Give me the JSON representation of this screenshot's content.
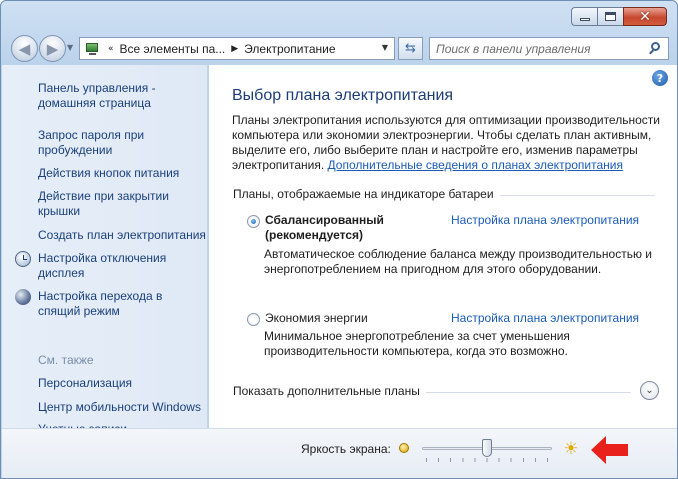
{
  "window": {
    "caption": {
      "minimize": "minimize",
      "maximize": "maximize",
      "close": "close"
    }
  },
  "nav": {
    "breadcrumbs": [
      "Все элементы па...",
      "Электропитание"
    ],
    "search_placeholder": "Поиск в панели управления"
  },
  "sidebar": {
    "links": [
      {
        "label": "Панель управления - домашняя страница",
        "icon": ""
      },
      {
        "label": "Запрос пароля при пробуждении",
        "icon": ""
      },
      {
        "label": "Действия кнопок питания",
        "icon": ""
      },
      {
        "label": "Действие при закрытии крышки",
        "icon": ""
      },
      {
        "label": "Создать план электропитания",
        "icon": ""
      },
      {
        "label": "Настройка отключения дисплея",
        "icon": "clock-icon"
      },
      {
        "label": "Настройка перехода в спящий режим",
        "icon": "moon-icon"
      }
    ],
    "see_also_title": "См. также",
    "see_also": [
      "Персонализация",
      "Центр мобильности Windows",
      "Учетные записи пользователей"
    ]
  },
  "main": {
    "title": "Выбор плана электропитания",
    "description": "Планы электропитания используются для оптимизации производительности компьютера или экономии электроэнергии. Чтобы сделать план активным, выделите его, либо выберите план и настройте его, изменив параметры электропитания.",
    "more_info_link": "Дополнительные сведения о планах электропитания",
    "battery_group_label": "Планы, отображаемые на индикаторе батареи",
    "plans": [
      {
        "name": "Сбалансированный (рекомендуется)",
        "selected": true,
        "settings_link": "Настройка плана электропитания",
        "description": "Автоматическое соблюдение баланса между производительностью и энергопотреблением на пригодном для этого оборудовании."
      },
      {
        "name": "Экономия энергии",
        "selected": false,
        "settings_link": "Настройка плана электропитания",
        "description": "Минимальное энергопотребление за счет уменьшения производительности компьютера, когда это возможно."
      }
    ],
    "show_more_plans": "Показать дополнительные планы"
  },
  "brightness": {
    "label": "Яркость экрана:",
    "level_fraction": 0.5,
    "arrow_color": "#e8211d"
  }
}
